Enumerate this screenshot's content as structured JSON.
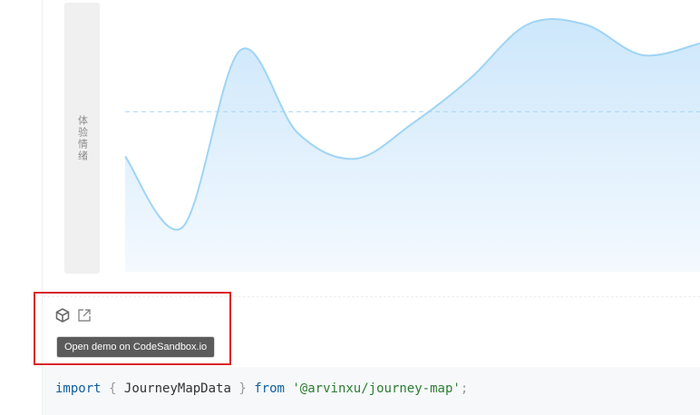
{
  "chart_data": {
    "type": "area",
    "ylabel": "体验情绪",
    "points": [
      {
        "x": 0,
        "y": 0.44
      },
      {
        "x": 1,
        "y": 0.14
      },
      {
        "x": 2,
        "y": 0.89
      },
      {
        "x": 3,
        "y": 0.54
      },
      {
        "x": 4,
        "y": 0.43
      },
      {
        "x": 5,
        "y": 0.58
      },
      {
        "x": 6,
        "y": 0.77
      },
      {
        "x": 7,
        "y": 1.0
      },
      {
        "x": 8,
        "y": 1.0
      },
      {
        "x": 9,
        "y": 0.87
      },
      {
        "x": 10,
        "y": 0.92
      }
    ],
    "baseline": 0.63,
    "colors": {
      "stroke": "#9fd4f5",
      "fill_top": "#cde7fb",
      "fill_bottom": "#f4f9fe",
      "baseline": "#a6d4f5"
    }
  },
  "toolbar": {
    "codesandbox_icon": "cube-icon",
    "open_icon": "external-link-icon",
    "tooltip": "Open demo on CodeSandbox.io"
  },
  "code": {
    "kw_import": "import",
    "brace_open": "{",
    "name": "JourneyMapData",
    "brace_close": "}",
    "kw_from": "from",
    "module": "'@arvinxu/journey-map'",
    "semi": ";"
  },
  "colors": {
    "highlight": "#d9262a",
    "tooltip_bg": "#5b5b5b",
    "code_bg": "#f6f8fa"
  }
}
